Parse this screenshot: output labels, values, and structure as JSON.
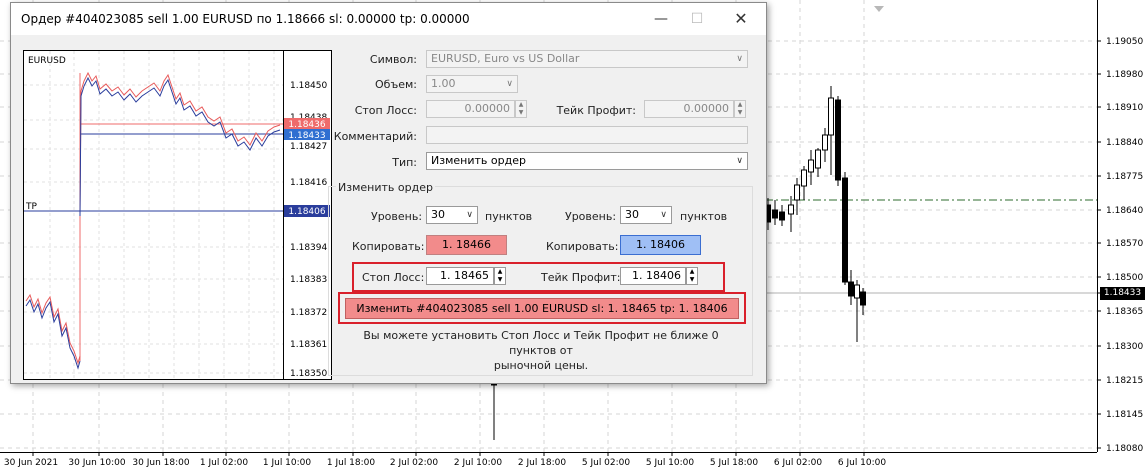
{
  "background_chart": {
    "price_labels": [
      "1.19050",
      "1.18980",
      "1.18910",
      "1.18840",
      "1.18775",
      "1.18640",
      "1.18570",
      "1.18500",
      "1.18433",
      "1.18365",
      "1.18300",
      "1.18215",
      "1.18145",
      "1.18080"
    ],
    "current_price": "1.18433",
    "time_labels": [
      "30 Jun 2021",
      "30 Jun 10:00",
      "30 Jun 18:00",
      "1 Jul 02:00",
      "1 Jul 10:00",
      "1 Jul 18:00",
      "2 Jul 02:00",
      "2 Jul 10:00",
      "2 Jul 18:00",
      "5 Jul 02:00",
      "5 Jul 10:00",
      "5 Jul 18:00",
      "6 Jul 02:00",
      "6 Jul 10:00"
    ]
  },
  "dialog": {
    "title": "Ордер #404023085 sell 1.00 EURUSD по 1.18666 sl: 0.00000 tp: 0.00000",
    "minimize_icon": "minimize-icon",
    "maximize_icon": "maximize-icon",
    "close_icon": "close-icon"
  },
  "mini_chart": {
    "symbol": "EURUSD",
    "tp_label": "TP",
    "price_labels": [
      "1.18450",
      "1.18438",
      "1.18427",
      "1.18416",
      "1.18394",
      "1.18383",
      "1.18372",
      "1.18361",
      "1.18350"
    ],
    "tags": {
      "sell": "1.18436",
      "buy": "1.18433",
      "tp": "1.18406"
    },
    "colors": {
      "bid_line": "#2a3d9c",
      "ask_line": "#e85a5a",
      "tp_line": "#2a3d9c",
      "sell_tag": "#ef6b6b",
      "buy_tag": "#2f6fd1"
    }
  },
  "form": {
    "symbol_label": "Символ:",
    "symbol_value": "EURUSD, Euro vs US Dollar",
    "volume_label": "Объем:",
    "volume_value": "1.00",
    "sl_label": "Стоп Лосс:",
    "sl_value": "0.00000",
    "tp_label": "Тейк Профит:",
    "tp_value": "0.00000",
    "comment_label": "Комментарий:",
    "comment_value": "",
    "type_label": "Тип:",
    "type_value": "Изменить ордер"
  },
  "modify": {
    "group_label": "Изменить ордер",
    "level_label": "Уровень:",
    "sl_level": "30",
    "tp_level": "30",
    "points_label": "пунктов",
    "copy_label": "Копировать:",
    "copy_sl_value": "1. 18466",
    "copy_tp_value": "1. 18406",
    "sl_label": "Стоп Лосс:",
    "sl_value": "1. 18465",
    "tp_label": "Тейк Профит:",
    "tp_value": "1. 18406",
    "button_label": "Изменить #404023085 sell 1.00 EURUSD sl: 1. 18465 tp: 1. 18406",
    "hint_line1": "Вы можете установить Стоп Лосс и Тейк Профит не ближе 0 пунктов от",
    "hint_line2": "рыночной цены.",
    "colors": {
      "copy_sl_bg": "#f28b8b",
      "copy_tp_bg": "#9fbff5",
      "highlight": "#d9202b"
    }
  }
}
